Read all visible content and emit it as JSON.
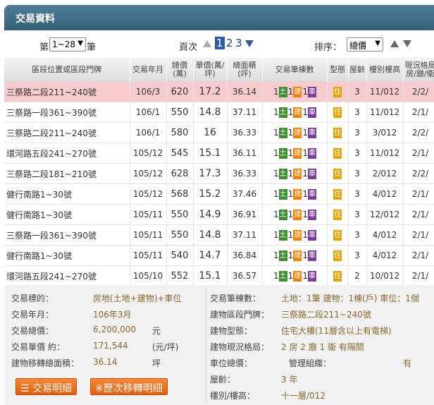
{
  "header": {
    "title": "交易資料"
  },
  "pager": {
    "prefix": "第",
    "range_value": "1~28",
    "suffix": "筆",
    "page_label": "頁次",
    "pages": [
      "1",
      "2",
      "3"
    ],
    "current_page": "1",
    "sort_label": "排序：",
    "sort_value": "總價"
  },
  "table": {
    "headers": [
      {
        "text": "區段位置或區段門牌"
      },
      {
        "text": "交易年月"
      },
      {
        "text": "總價(萬)"
      },
      {
        "text": "單價(萬/坪)"
      },
      {
        "text": "總面積(坪)"
      },
      {
        "text": "交易筆棟數"
      },
      {
        "text": "型態"
      },
      {
        "text": "屋齡"
      },
      {
        "text": "樓別樓高"
      },
      {
        "text": "現況格局房/廳/衛"
      }
    ],
    "badge_labels": {
      "land": "土",
      "bld": "建",
      "car": "車",
      "res": "住"
    },
    "rows": [
      {
        "addr": "三祭路二段211~240號",
        "date": "106/3",
        "price": "620",
        "unit": "17.2",
        "area": "36.14",
        "land": "1",
        "bld": "1",
        "car": "1",
        "age": "3",
        "floor": "11/012",
        "layout": "2/2/"
      },
      {
        "addr": "三祭路一段361~390號",
        "date": "106/1",
        "price": "550",
        "unit": "14.8",
        "area": "37.11",
        "land": "1",
        "bld": "1",
        "car": "1",
        "age": "3",
        "floor": "11/012",
        "layout": "2/1/"
      },
      {
        "addr": "三祭路二段211~240號",
        "date": "106/1",
        "price": "580",
        "unit": "16",
        "area": "36.33",
        "land": "1",
        "bld": "1",
        "car": "1",
        "age": "3",
        "floor": "3/012",
        "layout": "2/2/"
      },
      {
        "addr": "環河路五段241~270號",
        "date": "105/12",
        "price": "545",
        "unit": "15.1",
        "area": "36.11",
        "land": "1",
        "bld": "1",
        "car": "1",
        "age": "3",
        "floor": "11/012",
        "layout": "2/1/"
      },
      {
        "addr": "三祭路二段181~210號",
        "date": "105/12",
        "price": "628",
        "unit": "17.3",
        "area": "36.33",
        "land": "1",
        "bld": "1",
        "car": "1",
        "age": "3",
        "floor": "2/012",
        "layout": "2/2/"
      },
      {
        "addr": "健行南路1~30號",
        "date": "105/12",
        "price": "568",
        "unit": "15.2",
        "area": "37.46",
        "land": "1",
        "bld": "1",
        "car": "1",
        "age": "3",
        "floor": "4/012",
        "layout": "2/1/"
      },
      {
        "addr": "健行南路1~30號",
        "date": "105/11",
        "price": "550",
        "unit": "14.9",
        "area": "36.91",
        "land": "1",
        "bld": "1",
        "car": "1",
        "age": "3",
        "floor": "12/012",
        "layout": "2/1/"
      },
      {
        "addr": "三祭路一段361~390號",
        "date": "105/11",
        "price": "550",
        "unit": "14.8",
        "area": "37.11",
        "land": "1",
        "bld": "1",
        "car": "1",
        "age": "3",
        "floor": "4/012",
        "layout": "2/1/"
      },
      {
        "addr": "健行南路1~30號",
        "date": "105/11",
        "price": "540",
        "unit": "14.7",
        "area": "36.84",
        "land": "1",
        "bld": "1",
        "car": "1",
        "age": "3",
        "floor": "4/012",
        "layout": "2/1/"
      },
      {
        "addr": "環河路五段241~270號",
        "date": "105/10",
        "price": "552",
        "unit": "15.1",
        "area": "36.57",
        "land": "1",
        "bld": "1",
        "car": "1",
        "age": "2",
        "floor": "10/012",
        "layout": "2/1/"
      }
    ]
  },
  "detail": {
    "left": [
      {
        "label": "交易標的：",
        "value": "房地(土地+建物)+車位",
        "unit": ""
      },
      {
        "label": "交易年月：",
        "value": "106年3月",
        "unit": ""
      },
      {
        "label": "交易總價：",
        "value": "6,200,000",
        "unit": "元"
      },
      {
        "label": "交易單價 約：",
        "value": "171,544",
        "unit": "(元/坪)"
      },
      {
        "label": "建物移轉總面積：",
        "value": "36.14",
        "unit": "坪"
      }
    ],
    "right": [
      {
        "label": "交易筆棟數：",
        "value": "土地：1筆 建物：1棟(戶) 車位：1個"
      },
      {
        "label": "建物區段門牌：",
        "value": "三祭路二段211~240號"
      },
      {
        "label": "建物型態：",
        "value": "住宅大樓(11層含以上有電梯)"
      },
      {
        "label": "建物現況格局：",
        "value": "2 房 2 廳 1 衛 有隔間"
      },
      {
        "label": "車位總價：",
        "value": "",
        "extra_label": "管理組織：",
        "extra_value": "有"
      },
      {
        "label": "屋齡：",
        "value": "3 年"
      },
      {
        "label": "樓別/樓高：",
        "value": "十一層/012"
      }
    ],
    "buttons": {
      "trade_detail": "交易明細",
      "history": "※歷次移轉明細"
    }
  }
}
